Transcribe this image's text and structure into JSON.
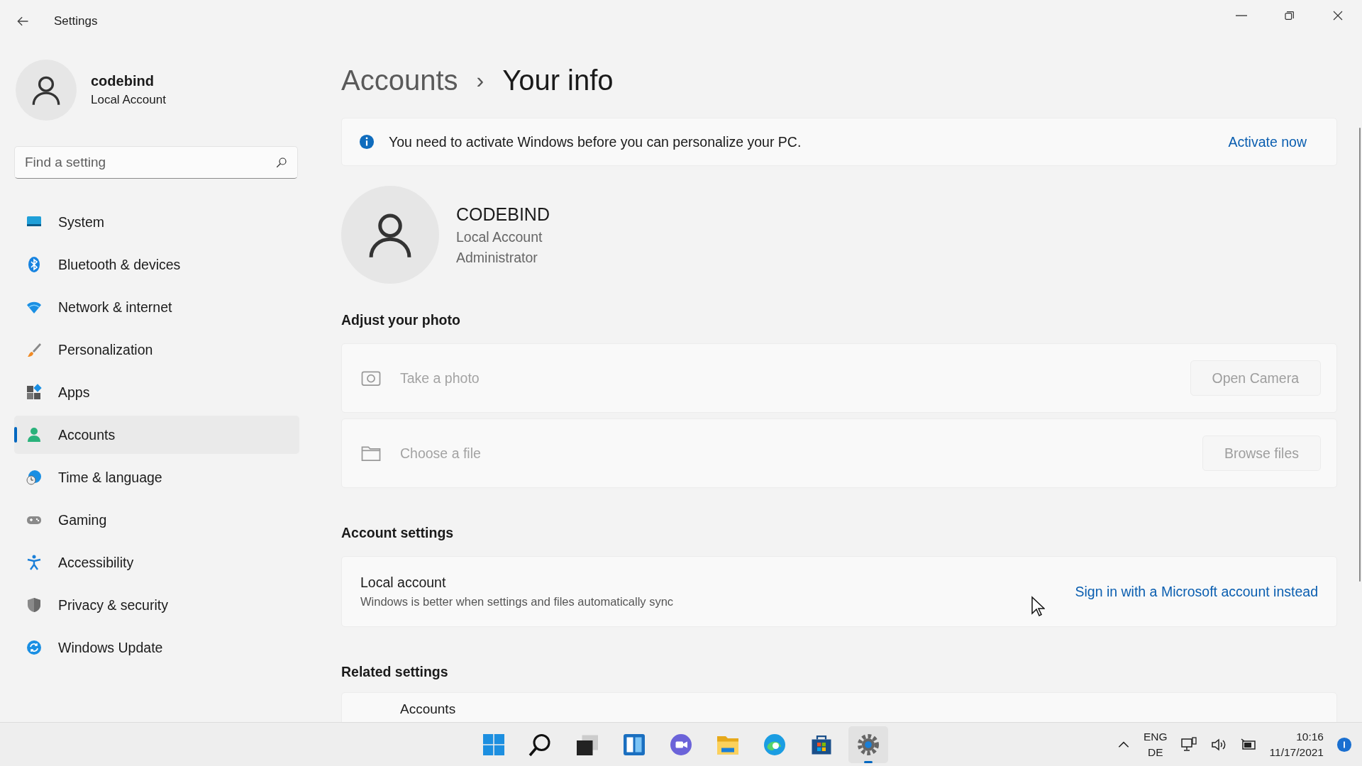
{
  "window": {
    "title": "Settings"
  },
  "user": {
    "name": "codebind",
    "account_type": "Local Account"
  },
  "search": {
    "placeholder": "Find a setting"
  },
  "nav": [
    {
      "label": "System",
      "selected": false
    },
    {
      "label": "Bluetooth & devices",
      "selected": false
    },
    {
      "label": "Network & internet",
      "selected": false
    },
    {
      "label": "Personalization",
      "selected": false
    },
    {
      "label": "Apps",
      "selected": false
    },
    {
      "label": "Accounts",
      "selected": true
    },
    {
      "label": "Time & language",
      "selected": false
    },
    {
      "label": "Gaming",
      "selected": false
    },
    {
      "label": "Accessibility",
      "selected": false
    },
    {
      "label": "Privacy & security",
      "selected": false
    },
    {
      "label": "Windows Update",
      "selected": false
    }
  ],
  "breadcrumb": {
    "parent": "Accounts",
    "separator": "›",
    "current": "Your info"
  },
  "banner": {
    "message": "You need to activate Windows before you can personalize your PC.",
    "action": "Activate now"
  },
  "profile": {
    "name": "CODEBIND",
    "lines": [
      "Local Account",
      "Administrator"
    ]
  },
  "photo_section": {
    "heading": "Adjust your photo",
    "rows": [
      {
        "label": "Take a photo",
        "button": "Open Camera",
        "disabled": true
      },
      {
        "label": "Choose a file",
        "button": "Browse files",
        "disabled": true
      }
    ]
  },
  "account_settings": {
    "heading": "Account settings",
    "title": "Local account",
    "description": "Windows is better when settings and files automatically sync",
    "link": "Sign in with a Microsoft account instead"
  },
  "related_settings": {
    "heading": "Related settings",
    "items": [
      {
        "label": "Accounts"
      }
    ]
  },
  "taskbar": {
    "apps": [
      {
        "selected": false
      },
      {
        "selected": false
      },
      {
        "selected": false
      },
      {
        "selected": false
      },
      {
        "selected": false
      },
      {
        "selected": false
      },
      {
        "selected": false
      },
      {
        "selected": false
      },
      {
        "selected": true
      }
    ],
    "language": [
      "ENG",
      "DE"
    ],
    "time": "10:16",
    "date": "11/17/2021"
  }
}
